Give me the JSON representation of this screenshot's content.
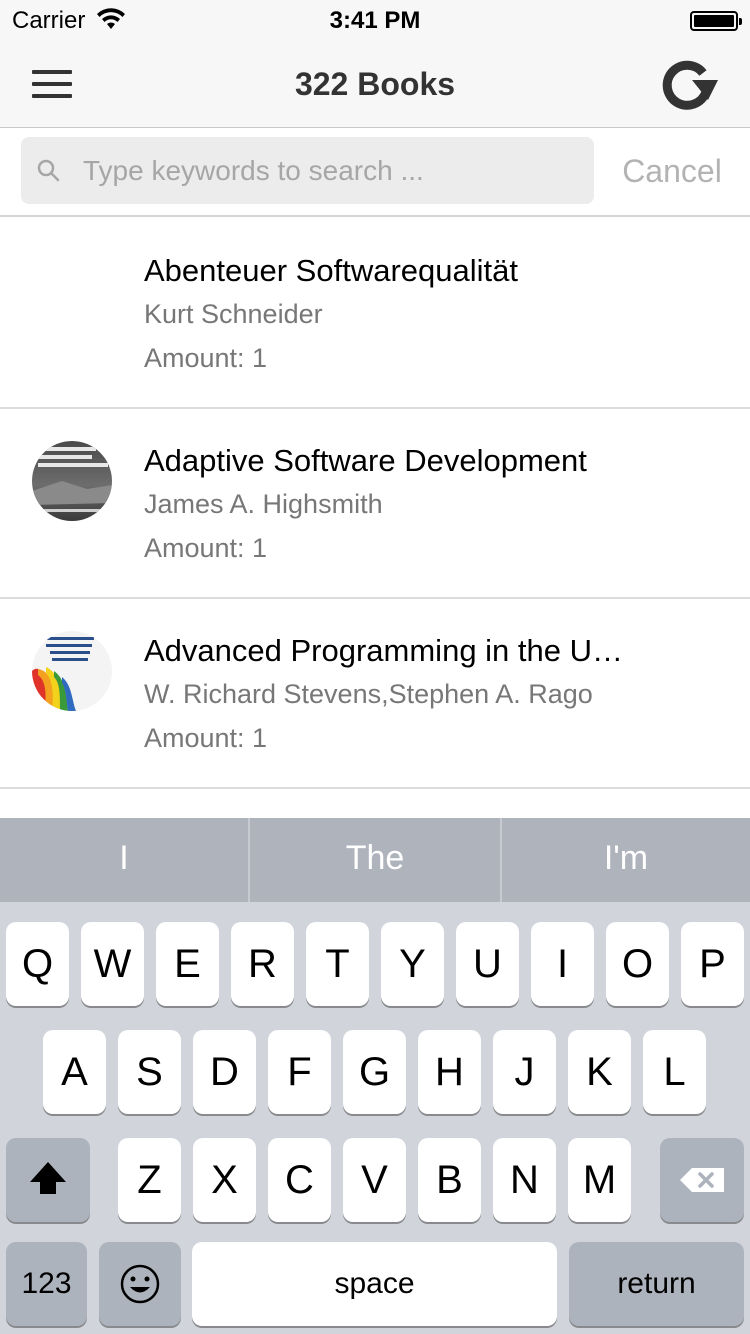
{
  "status_bar": {
    "carrier": "Carrier",
    "time": "3:41 PM"
  },
  "nav": {
    "title": "322 Books",
    "menu_icon": "hamburger-menu-icon",
    "refresh_icon": "refresh-icon"
  },
  "search": {
    "placeholder": "Type keywords to search ...",
    "value": "",
    "cancel_label": "Cancel"
  },
  "books": [
    {
      "title": "Abenteuer Softwarequalität",
      "author": "Kurt Schneider",
      "amount": "Amount: 1",
      "cover": "none"
    },
    {
      "title": "Adaptive Software Development",
      "author": "James A. Highsmith",
      "amount": "Amount: 1",
      "cover": "book-cover-dark"
    },
    {
      "title": "Advanced Programming in the UNIX Environment",
      "author": "W. Richard Stevens,Stephen A. Rago",
      "amount": "Amount: 1",
      "cover": "book-cover-colorful"
    }
  ],
  "keyboard": {
    "predictions": [
      "I",
      "The",
      "I'm"
    ],
    "row1": [
      "Q",
      "W",
      "E",
      "R",
      "T",
      "Y",
      "U",
      "I",
      "O",
      "P"
    ],
    "row2": [
      "A",
      "S",
      "D",
      "F",
      "G",
      "H",
      "J",
      "K",
      "L"
    ],
    "row3": [
      "Z",
      "X",
      "C",
      "V",
      "B",
      "N",
      "M"
    ],
    "numbers_label": "123",
    "space_label": "space",
    "return_label": "return"
  },
  "colors": {
    "nav_background": "#f7f7f7",
    "keyboard_background": "#d1d5db",
    "predictive_bar": "#aeb3bc",
    "secondary_text": "#777777",
    "cancel_text": "#b3b3b3"
  }
}
